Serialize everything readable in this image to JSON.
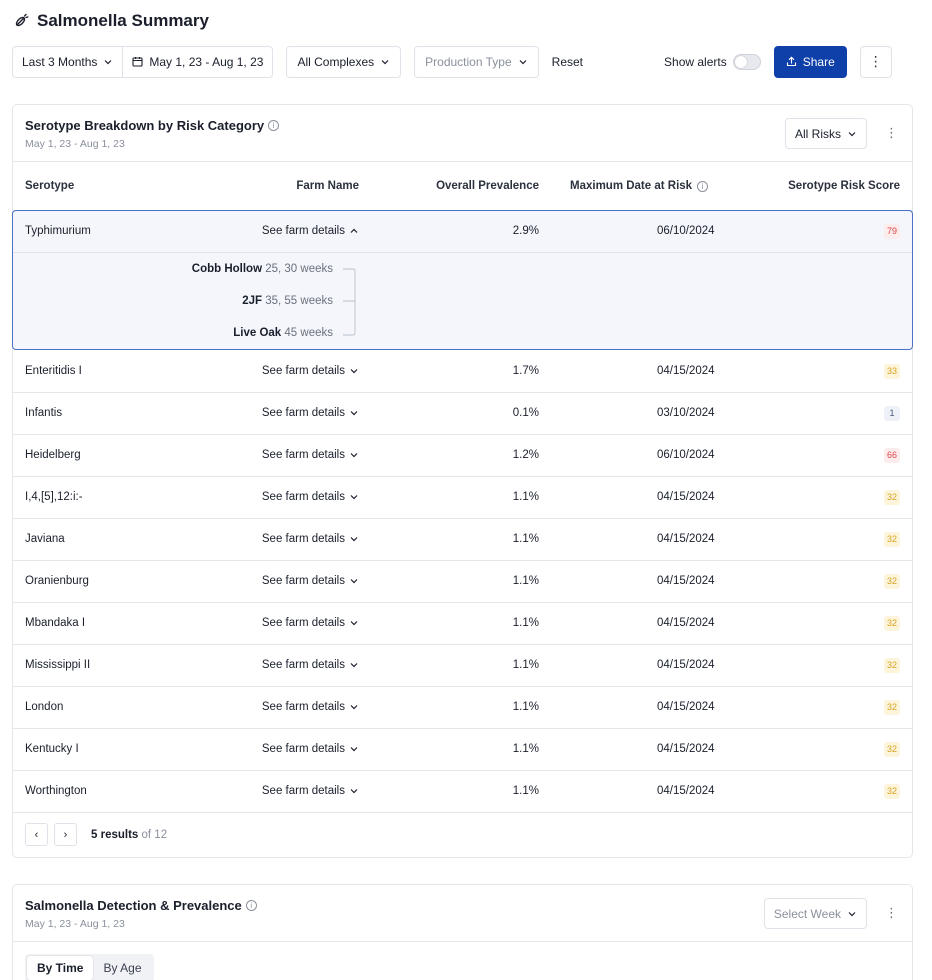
{
  "page": {
    "title": "Salmonella Summary"
  },
  "toolbar": {
    "range_label": "Last 3 Months",
    "date_range": "May 1, 23 - Aug 1, 23",
    "complexes_label": "All Complexes",
    "production_type_placeholder": "Production Type",
    "reset_label": "Reset",
    "show_alerts_label": "Show alerts",
    "share_label": "Share"
  },
  "serotype_card": {
    "title": "Serotype Breakdown by Risk Category",
    "subtitle": "May 1, 23 - Aug 1, 23",
    "risk_filter": "All Risks",
    "columns": {
      "serotype": "Serotype",
      "farm_name": "Farm Name",
      "prevalence": "Overall Prevalence",
      "max_date": "Maximum Date at Risk",
      "risk_score": "Serotype Risk Score"
    },
    "expanded_row": {
      "serotype": "Typhimurium",
      "farm": "See farm details",
      "prevalence": "2.9%",
      "date": "06/10/2024",
      "score": "79",
      "details": [
        {
          "farm": "Cobb Hollow",
          "weeks": "25, 30 weeks"
        },
        {
          "farm": "2JF",
          "weeks": "35, 55 weeks"
        },
        {
          "farm": "Live Oak",
          "weeks": "45 weeks"
        }
      ]
    },
    "rows": [
      {
        "serotype": "Enteritidis I",
        "farm": "See farm details",
        "prevalence": "1.7%",
        "date": "04/15/2024",
        "score": "33",
        "level": "medium"
      },
      {
        "serotype": "Infantis",
        "farm": "See farm details",
        "prevalence": "0.1%",
        "date": "03/10/2024",
        "score": "1",
        "level": "low"
      },
      {
        "serotype": "Heidelberg",
        "farm": "See farm details",
        "prevalence": "1.2%",
        "date": "06/10/2024",
        "score": "66",
        "level": "high"
      },
      {
        "serotype": "I,4,[5],12:i:-",
        "farm": "See farm details",
        "prevalence": "1.1%",
        "date": "04/15/2024",
        "score": "32",
        "level": "medium"
      },
      {
        "serotype": "Javiana",
        "farm": "See farm details",
        "prevalence": "1.1%",
        "date": "04/15/2024",
        "score": "32",
        "level": "medium"
      },
      {
        "serotype": "Oranienburg",
        "farm": "See farm details",
        "prevalence": "1.1%",
        "date": "04/15/2024",
        "score": "32",
        "level": "medium"
      },
      {
        "serotype": "Mbandaka I",
        "farm": "See farm details",
        "prevalence": "1.1%",
        "date": "04/15/2024",
        "score": "32",
        "level": "medium"
      },
      {
        "serotype": "Mississippi II",
        "farm": "See farm details",
        "prevalence": "1.1%",
        "date": "04/15/2024",
        "score": "32",
        "level": "medium"
      },
      {
        "serotype": "London",
        "farm": "See farm details",
        "prevalence": "1.1%",
        "date": "04/15/2024",
        "score": "32",
        "level": "medium"
      },
      {
        "serotype": "Kentucky I",
        "farm": "See farm details",
        "prevalence": "1.1%",
        "date": "04/15/2024",
        "score": "32",
        "level": "medium"
      },
      {
        "serotype": "Worthington",
        "farm": "See farm details",
        "prevalence": "1.1%",
        "date": "04/15/2024",
        "score": "32",
        "level": "medium"
      }
    ],
    "pagination": {
      "results": "5 results",
      "of": "of 12"
    }
  },
  "detection_card": {
    "title": "Salmonella Detection & Prevalence",
    "subtitle": "May 1, 23 - Aug 1, 23",
    "week_placeholder": "Select Week",
    "tabs": [
      "By Time",
      "By Age"
    ]
  },
  "colors": {
    "primary": "#0f3fa8",
    "high_bg": "#fdecec",
    "high_fg": "#e0474c",
    "medium_bg": "#fdf4dc",
    "medium_fg": "#d9a322",
    "low_bg": "#eef1f7",
    "low_fg": "#4a5a7a"
  }
}
